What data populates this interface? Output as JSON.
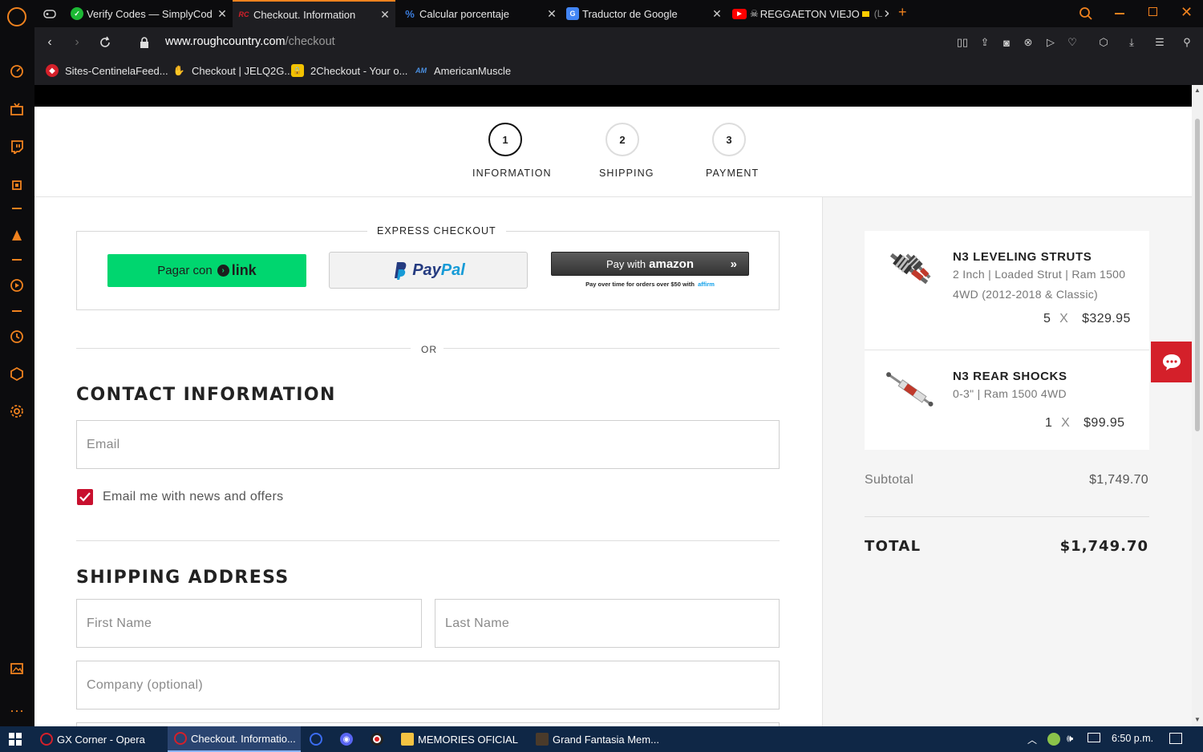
{
  "browser": {
    "tabs": [
      {
        "title": "Verify Codes — SimplyCod",
        "icon": "check-circle-icon",
        "color": "#1cb834"
      },
      {
        "title": "Checkout. Information",
        "icon": "rc-logo-icon",
        "color": "#d4202a",
        "active": true
      },
      {
        "title": "Calcular porcentaje",
        "icon": "percent-icon",
        "color": "#3b7ddd"
      },
      {
        "title": "Traductor de Google",
        "icon": "google-translate-icon",
        "color": "#4285f4"
      },
      {
        "title": "REGGAETON VIEJO",
        "icon": "youtube-icon",
        "color": "#ff0000",
        "suffix": "(L"
      }
    ],
    "url_domain": "www.roughcountry.com",
    "url_path": "/checkout",
    "bookmarks": [
      {
        "label": "Sites-CentinelaFeed...",
        "icon": "shield-icon"
      },
      {
        "label": "Checkout | JELQ2G...",
        "icon": "hand-icon"
      },
      {
        "label": "2Checkout - Your o...",
        "icon": "lock-icon"
      },
      {
        "label": "AmericanMuscle",
        "icon": "am-logo-icon"
      }
    ]
  },
  "steps": [
    {
      "number": "1",
      "label": "INFORMATION",
      "active": true
    },
    {
      "number": "2",
      "label": "SHIPPING",
      "active": false
    },
    {
      "number": "3",
      "label": "PAYMENT",
      "active": false
    }
  ],
  "express": {
    "title": "EXPRESS CHECKOUT",
    "link_button": {
      "prefix": "Pagar con",
      "brand": "link"
    },
    "paypal_button": {
      "pay": "Pay",
      "pal": "Pal"
    },
    "amazon_button": {
      "label": "Pay with",
      "brand": "amazon"
    },
    "affirm_note": "Pay over time for orders over $50 with",
    "affirm_brand": "affirm"
  },
  "divider": {
    "or_label": "OR"
  },
  "contact": {
    "heading": "CONTACT INFORMATION",
    "email_placeholder": "Email",
    "newsletter_label": "Email me with news and offers",
    "newsletter_checked": true
  },
  "shipping": {
    "heading": "SHIPPING ADDRESS",
    "first_name_placeholder": "First Name",
    "last_name_placeholder": "Last Name",
    "company_placeholder": "Company (optional)"
  },
  "summary": {
    "items": [
      {
        "name": "N3 LEVELING STRUTS",
        "sub_line1": "2 Inch | Loaded Strut | Ram 1500",
        "sub_line2": "4WD (2012-2018 & Classic)",
        "qty": "5",
        "x": "X",
        "price": "$329.95"
      },
      {
        "name": "N3 REAR SHOCKS",
        "sub_line1": "0-3\" | Ram 1500 4WD",
        "qty": "1",
        "x": "X",
        "price": "$99.95"
      }
    ],
    "subtotal_label": "Subtotal",
    "subtotal_value": "$1,749.70",
    "total_label": "TOTAL",
    "total_value": "$1,749.70"
  },
  "taskbar": {
    "items": [
      {
        "label": "GX Corner - Opera"
      },
      {
        "label": "Checkout. Informatio...",
        "active": true
      },
      {
        "label": "MEMORIES OFICIAL"
      },
      {
        "label": "Grand Fantasia Mem..."
      }
    ],
    "time": "6:50 p.m."
  },
  "colors": {
    "accent_orange": "#f0821e",
    "link_green": "#00d66f",
    "brand_red": "#d4202a",
    "checkbox_red": "#c8102e",
    "taskbar_blue": "#0f2746"
  }
}
